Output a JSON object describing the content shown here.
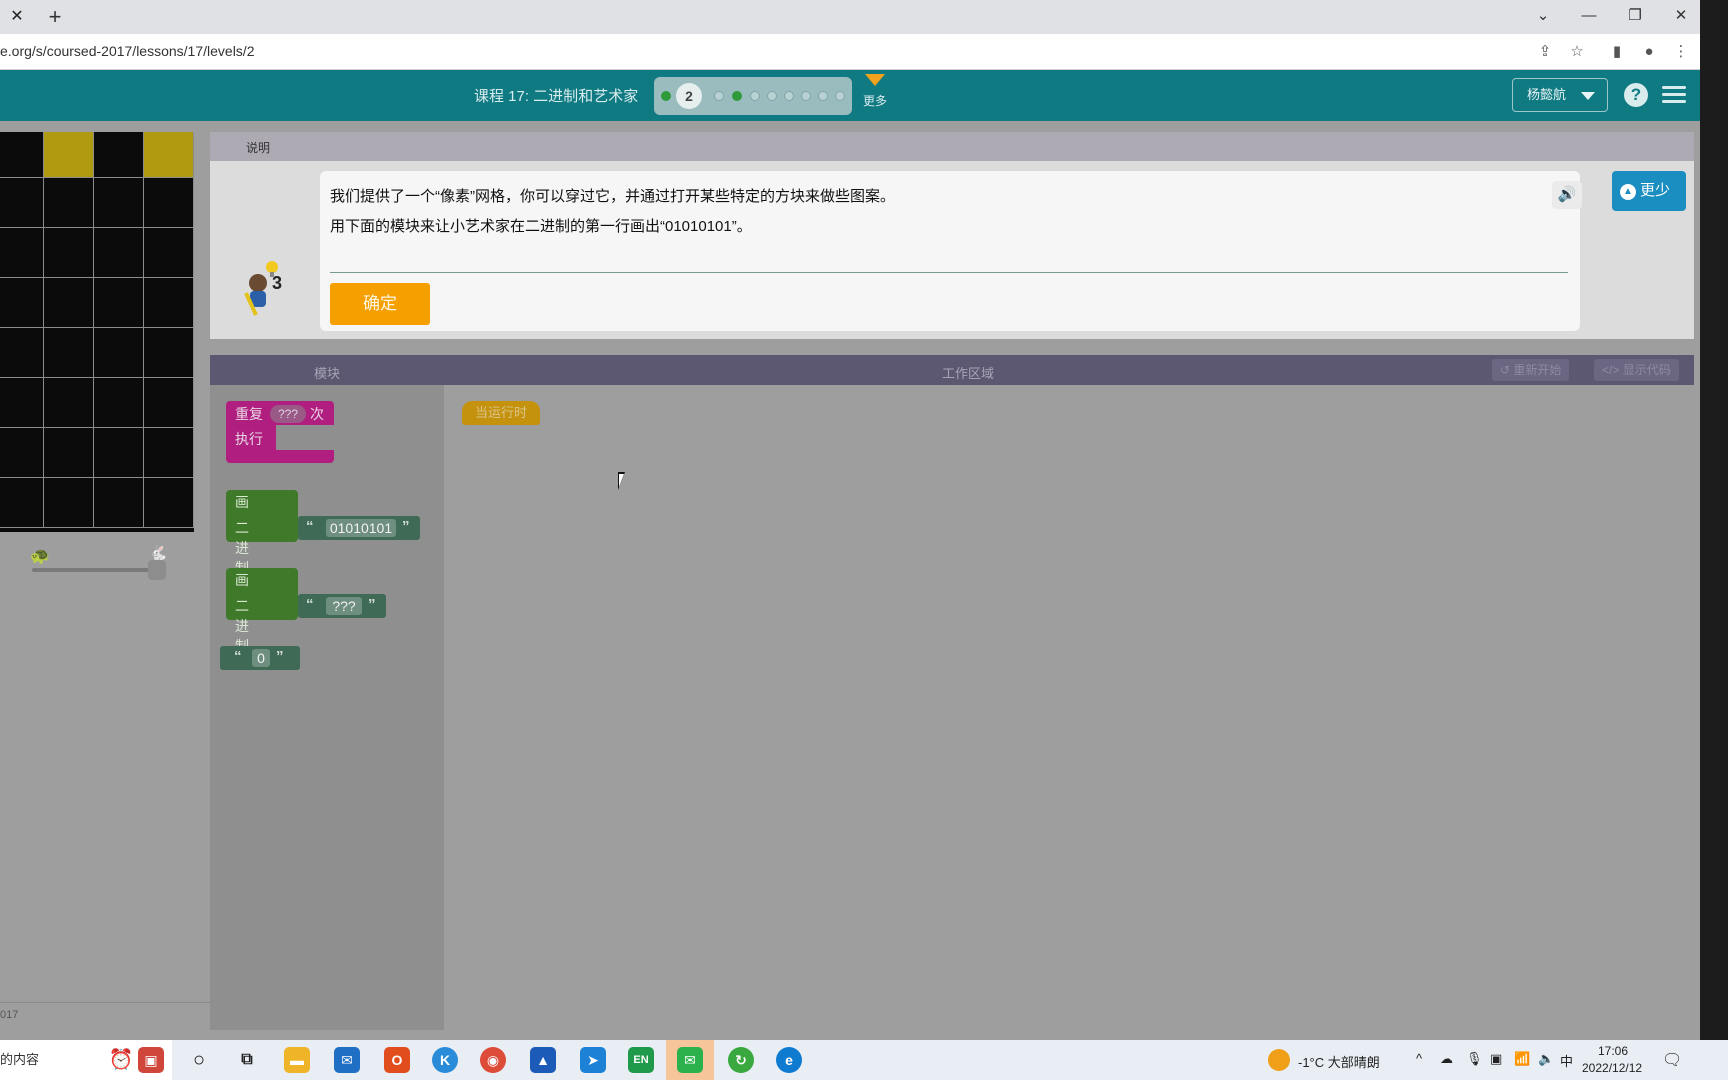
{
  "browser": {
    "tab_close": "✕",
    "tab_new": "+",
    "url": "e.org/s/coursed-2017/lessons/17/levels/2",
    "window_controls": [
      "⌄",
      "—",
      "❐",
      "✕"
    ]
  },
  "header": {
    "lesson_title": "课程 17: 二进制和艺术家",
    "current_level": "2",
    "more_label": "更多",
    "user_name": "杨懿航",
    "help": "?"
  },
  "instructions": {
    "tab_label": "说明",
    "hint_count": "3",
    "line1": "我们提供了一个“像素”网格，你可以穿过它，并通过打开某些特定的方块来做些图案。",
    "line2": "用下面的模块来让小艺术家在二进制的第一行画出“01010101”。",
    "ok_button": "确定",
    "less_button": "更少"
  },
  "workspace": {
    "toolbox_title": "模块",
    "workspace_title": "工作区域",
    "reset_button": "重新开始",
    "show_code_button": "显示代码",
    "when_run": "当运行时"
  },
  "blocks": {
    "repeat_label": "重复",
    "repeat_times_placeholder": "???",
    "repeat_suffix": "次",
    "repeat_do": "执行",
    "draw_label": "画",
    "binary_label": "二进制",
    "binary_value_1": "01010101",
    "binary_value_2": "???",
    "string_value": "0",
    "quote_open": "“",
    "quote_close": "”"
  },
  "footer_left": "017",
  "taskbar": {
    "search_text": "的内容",
    "weather": "-1°C  大部晴朗",
    "ime": "中",
    "time": "17:06",
    "date": "2022/12/12"
  }
}
